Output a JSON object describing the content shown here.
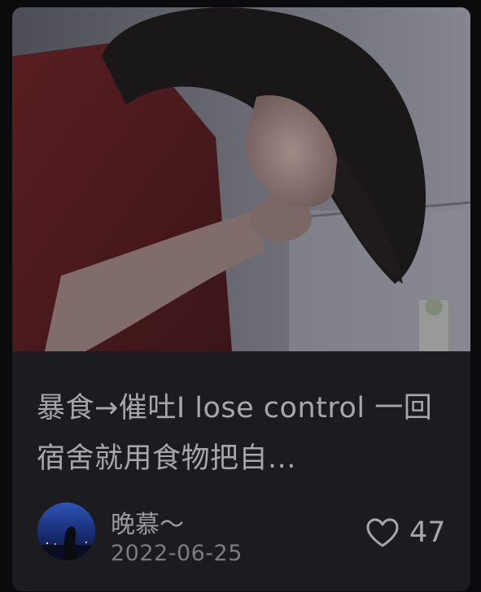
{
  "note": {
    "title": "暴食→催吐I lose control 一回宿舍就用食物把自...",
    "author": "晚慕～",
    "date": "2022-06-25",
    "likes": "47"
  },
  "icons": {
    "like": "heart-outline-icon"
  },
  "colors": {
    "card_background": "#1c1c20",
    "page_background": "#0b0b0d",
    "title_text": "#a6a6ac",
    "meta_text": "#7b7b82"
  }
}
